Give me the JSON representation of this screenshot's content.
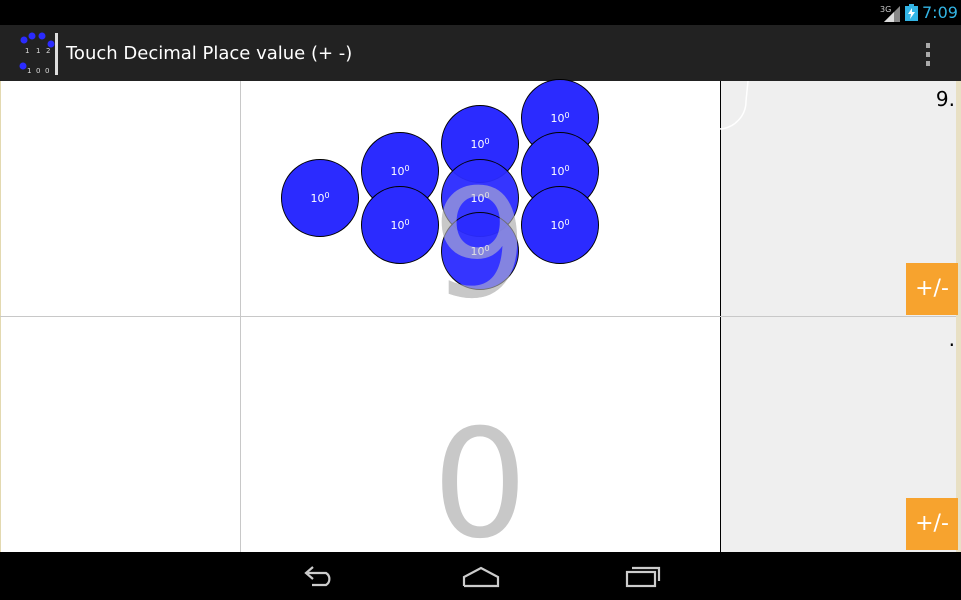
{
  "status_bar": {
    "network_label": "3G",
    "time": "7:09",
    "time_color": "#33b5e5",
    "icons": [
      "signal-icon",
      "battery-charging-icon"
    ]
  },
  "action_bar": {
    "title": "Touch Decimal Place value (+ -)",
    "background": "#222222",
    "logo_digits_top": [
      "1",
      "1",
      "2"
    ],
    "logo_digits_bottom": [
      "1",
      "0",
      "0"
    ],
    "overflow_menu_icon": "overflow-menu-icon"
  },
  "top_row": {
    "place_digit": "9",
    "value_display": "9.",
    "disc_label_base": "10",
    "disc_label_exponent": "0",
    "disc_count": 9,
    "plus_minus_label": "+/-"
  },
  "bottom_row": {
    "place_digit": "0",
    "value_display": ".",
    "plus_minus_label": "+/-"
  },
  "colors": {
    "disc_fill": "#2b2bff",
    "plus_minus_button": "#f7a32e",
    "digit_gray": "#c8c8c8",
    "panel_gray": "#efefef"
  },
  "nav_bar": {
    "buttons": [
      "back-icon",
      "home-icon",
      "recent-apps-icon"
    ]
  }
}
